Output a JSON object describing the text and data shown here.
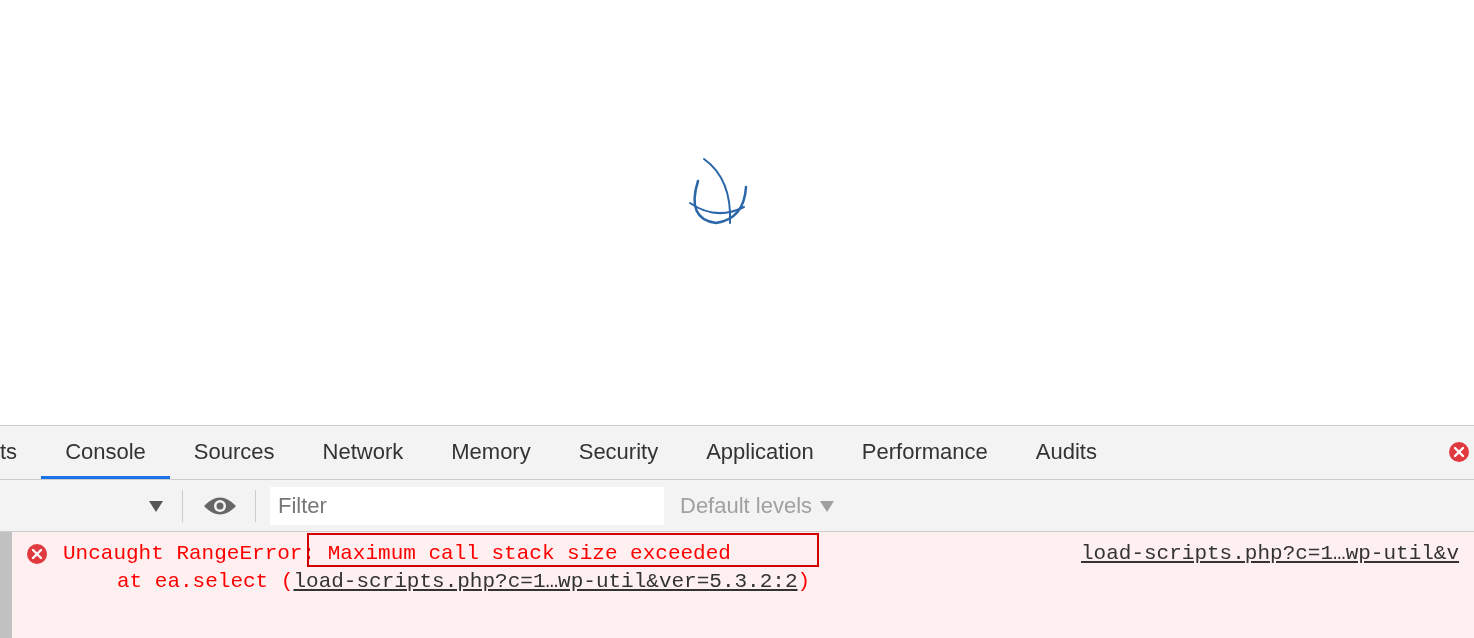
{
  "page": {
    "loading": true
  },
  "devtools": {
    "tabs": [
      {
        "label": "ts",
        "selected": false
      },
      {
        "label": "Console",
        "selected": true
      },
      {
        "label": "Sources",
        "selected": false
      },
      {
        "label": "Network",
        "selected": false
      },
      {
        "label": "Memory",
        "selected": false
      },
      {
        "label": "Security",
        "selected": false
      },
      {
        "label": "Application",
        "selected": false
      },
      {
        "label": "Performance",
        "selected": false
      },
      {
        "label": "Audits",
        "selected": false
      }
    ],
    "has_errors": true,
    "toolbar": {
      "filter": {
        "placeholder": "Filter"
      },
      "levels": "Default levels"
    },
    "messages": [
      {
        "kind": "error",
        "text": "Uncaught RangeError: Maximum call stack size exceeded",
        "highlighted": true,
        "source": "load-scripts.php?c=1…wp-util&v",
        "stack": [
          {
            "prefix": "at ea.select (",
            "link": "load-scripts.php?c=1…wp-util&ver=5.3.2:2",
            "suffix": ")"
          }
        ]
      }
    ]
  }
}
